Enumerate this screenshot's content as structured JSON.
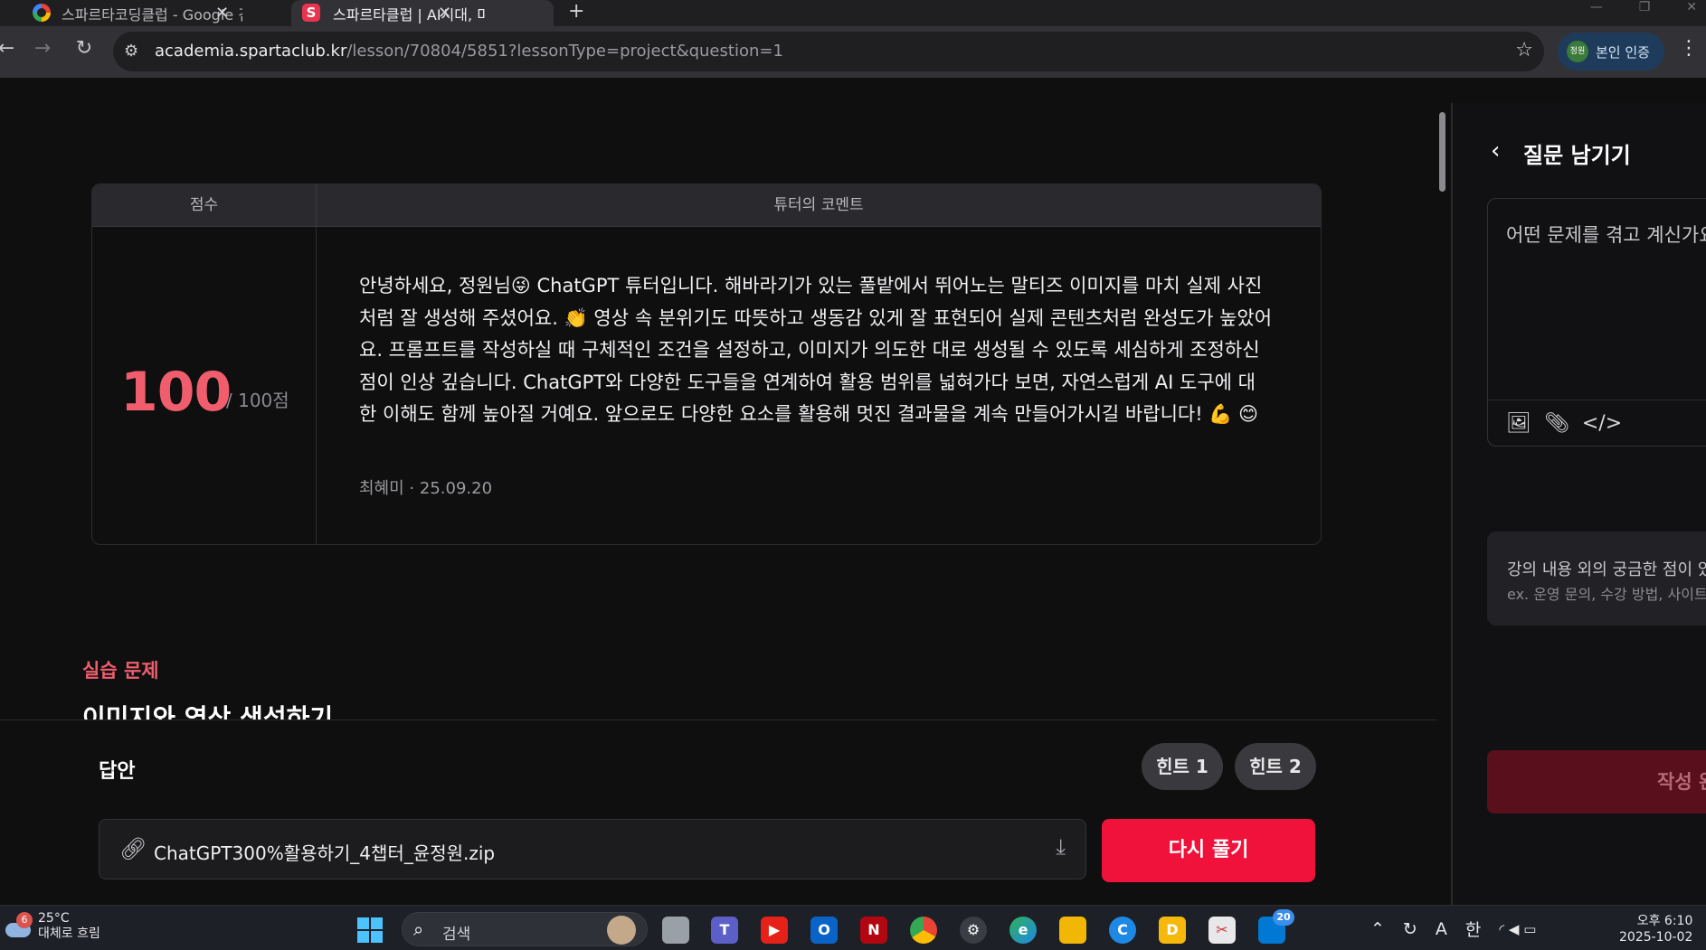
{
  "browser": {
    "tabs": [
      {
        "title": "스파르타코딩클럽 - Google 검색"
      },
      {
        "title": "스파르타클럽 | AI시대, 미래를"
      }
    ],
    "url_domain": "academia.spartaclub.kr",
    "url_path": "/lesson/70804/5851?lessonType=project&question=1",
    "verify_chip_label": "본인 인증",
    "verify_chip_badge": "정원"
  },
  "score_card": {
    "score_header": "점수",
    "comment_header": "튜터의 코멘트",
    "score": "100",
    "score_max": "/ 100점",
    "comment": "안녕하세요, 정원님😜 ChatGPT 튜터입니다. 해바라기가 있는 풀밭에서 뛰어노는 말티즈 이미지를 마치 실제 사진처럼 잘 생성해 주셨어요. 👏 영상 속 분위기도 따뜻하고 생동감 있게 잘 표현되어 실제 콘텐츠처럼 완성도가 높았어요. 프롬프트를 작성하실 때 구체적인 조건을 설정하고, 이미지가 의도한 대로 생성될 수 있도록 세심하게 조정하신 점이 인상 깊습니다. ChatGPT와 다양한 도구들을 연계하여 활용 범위를 넓혀가다 보면, 자연스럽게 AI 도구에 대한 이해도 함께 높아질 거예요. 앞으로도 다양한 요소를 활용해 멋진 결과물을 계속 만들어가시길 바랍니다! 💪 😊",
    "author": "최혜미",
    "date": "25.09.20"
  },
  "exercise": {
    "label": "실습 문제",
    "title": "이미지와 영상 생성하기"
  },
  "answer": {
    "label": "답안",
    "hint1": "힌트 1",
    "hint2": "힌트 2",
    "file_name": "ChatGPT300%활용하기_4챕터_윤정원.zip",
    "retry_label": "다시 풀기"
  },
  "side_panel": {
    "title": "질문 남기기",
    "placeholder": "어떤 문제를 겪고 계신가요",
    "info_line1": "강의 내용 외의 궁금한 점이 있",
    "info_line2": "ex. 운영 문의, 수강 방법, 사이트",
    "submit_label": "작성 완"
  },
  "taskbar": {
    "weather_badge": "6",
    "temperature": "25°C",
    "weather_desc": "대체로 흐림",
    "search_label": "검색",
    "notification_badge": "20",
    "ime_label": "한",
    "time": "오후 6:10",
    "date": "2025-10-02"
  },
  "colors": {
    "accent": "#f05e6e",
    "primary_button": "#f0123a",
    "background": "#0f0f10"
  }
}
